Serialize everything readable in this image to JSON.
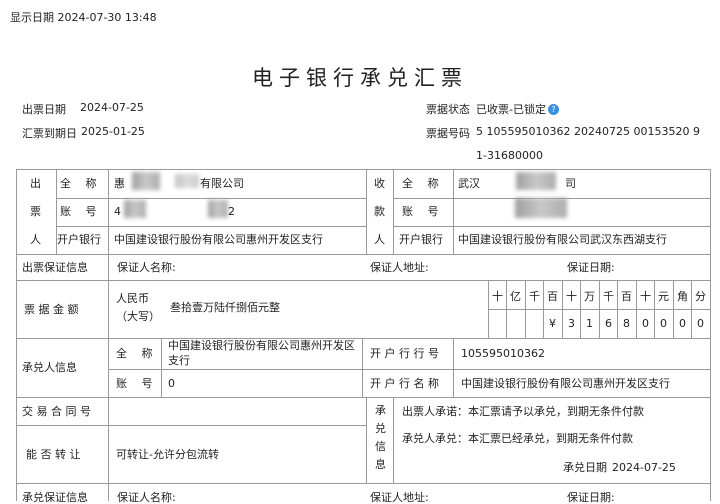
{
  "display_date": "显示日期 2024-07-30 13:48",
  "title": "电子银行承兑汇票",
  "issue_date_label": "出票日期",
  "issue_date": "2024-07-25",
  "due_date_label": "汇票到期日",
  "due_date": "2025-01-25",
  "status_label": "票据状态",
  "status": "已收票-已锁定",
  "bill_no_label": "票据号码",
  "bill_no": "5 105595010362 20240725 00153520 9",
  "bill_no_2": "1-31680000",
  "drawer": {
    "label_chars": [
      "出",
      "票",
      "人"
    ],
    "name_label": "全　 称",
    "name": "惠",
    "name_tail": "有限公司",
    "account_label": "账　 号",
    "account": "4",
    "account_tail": "2",
    "bank_label": "开户银行",
    "bank": "中国建设银行股份有限公司惠州开发区支行"
  },
  "payee": {
    "label_chars": [
      "收",
      "款",
      "人"
    ],
    "name_label": "全　 称",
    "name": "武汉",
    "name_tail": "司",
    "account_label": "账　 号",
    "account": "",
    "bank_label": "开户银行",
    "bank": "中国建设银行股份有限公司武汉东西湖支行"
  },
  "drawer_guarantee": {
    "label": "出票保证信息",
    "guarantor_name": "保证人名称:",
    "guarantor_addr": "保证人地址:",
    "guarantee_date": "保证日期:"
  },
  "amount": {
    "label": "票 据 金 额",
    "currency": "人民币",
    "currency_note": "（大写）",
    "in_words": "叁拾壹万陆仟捌佰元整",
    "digit_headers": [
      "十",
      "亿",
      "千",
      "百",
      "十",
      "万",
      "千",
      "百",
      "十",
      "元",
      "角",
      "分"
    ],
    "digits": [
      "",
      "",
      "",
      "¥",
      "3",
      "1",
      "6",
      "8",
      "0",
      "0",
      "0",
      "0"
    ]
  },
  "acceptor": {
    "label": "承兑人信息",
    "name_label": "全　 称",
    "name": "中国建设银行股份有限公司惠州开发区",
    "name_2": "支行",
    "account_label": "账　 号",
    "account": "0",
    "bank_no_label": "开 户 行 行 号",
    "bank_no": "105595010362",
    "bank_name_label": "开 户 行 名 称",
    "bank_name": "中国建设银行股份有限公司惠州开发区支行"
  },
  "contract": {
    "label": "交 易 合 同 号",
    "value": ""
  },
  "acceptance_info": {
    "label_chars": [
      "承",
      "兑",
      "信",
      "息"
    ],
    "drawer_promise": "出票人承诺：本汇票请予以承兑，到期无条件付款",
    "acceptor_promise": "承兑人承兑：本汇票已经承兑，到期无条件付款",
    "accept_date_label": "承兑日期",
    "accept_date": "2024-07-25"
  },
  "transferable": {
    "label": "能 否 转 让",
    "value": "可转让-允许分包流转"
  },
  "acceptor_guarantee": {
    "label": "承兑保证信息",
    "guarantor_name": "保证人名称:",
    "guarantor_addr": "保证人地址:",
    "guarantee_date": "保证日期:"
  },
  "colors": {
    "line": "#9a9a9a",
    "help_icon": "#3b8fe0"
  }
}
